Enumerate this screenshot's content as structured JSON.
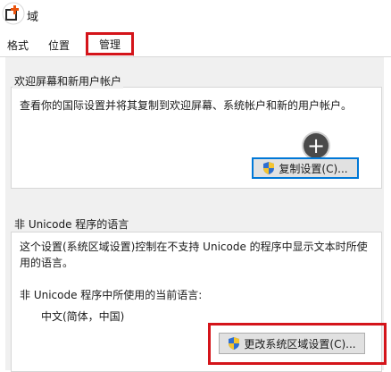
{
  "title": "区域",
  "title_visible": "域",
  "tabs": [
    {
      "label": "格式"
    },
    {
      "label": "位置"
    },
    {
      "label": "管理",
      "selected": true
    }
  ],
  "welcome_group": {
    "title": "欢迎屏幕和新用户帐户",
    "description": "查看你的国际设置并将其复制到欢迎屏幕、系统帐户和新的用户帐户。",
    "copy_button_label": "复制设置(C)..."
  },
  "non_unicode_group": {
    "title": "非 Unicode 程序的语言",
    "description": "这个设置(系统区域设置)控制在不支持 Unicode 的程序中显示文本时所使用的语言。",
    "current_label": "非 Unicode 程序中所使用的当前语言:",
    "current_value": "中文(简体，中国)",
    "change_button_label": "更改系统区域设置(C)..."
  },
  "colors": {
    "highlight": "#d4141a",
    "accent": "#0078d7",
    "logo_orange": "#e8530e"
  },
  "icons": [
    "app-logo-icon",
    "shield-icon",
    "plus-icon"
  ]
}
